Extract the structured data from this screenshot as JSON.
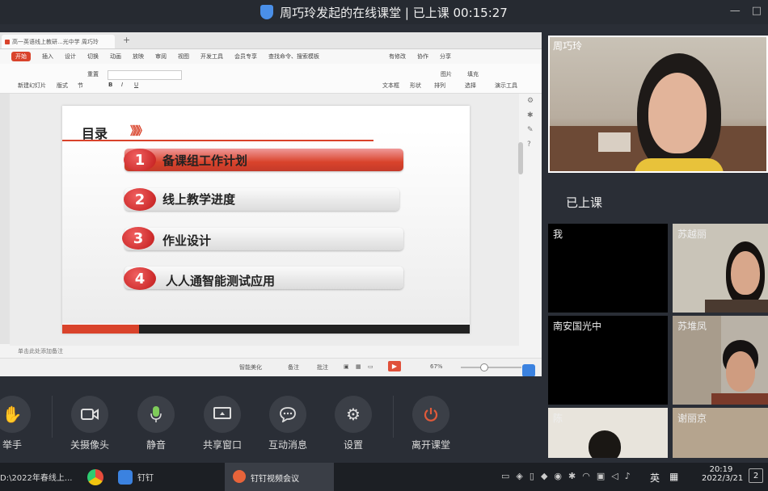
{
  "window": {
    "title": "周巧玲发起的在线课堂 | 已上课 00:15:27",
    "controls": [
      "—",
      "□"
    ]
  },
  "wps": {
    "doc_tab": "高一英语线上教研...光中学 周巧玲",
    "menu": [
      "开始",
      "插入",
      "设计",
      "切换",
      "动画",
      "放映",
      "审阅",
      "视图",
      "开发工具",
      "会员专享",
      "查找命令、搜索模板",
      "有修改",
      "协作",
      "分享"
    ],
    "ribbon": {
      "new_slide": "新建幻灯片",
      "layout": "版式",
      "section": "节",
      "reset": "重置",
      "textbox": "文本框",
      "shape": "形状",
      "arrange": "排列",
      "image": "图片",
      "fill": "填充",
      "play": "演示工具",
      "select": "选择"
    },
    "note_placeholder": "单击此处添加备注",
    "status": {
      "beautify": "智能美化",
      "notes": "备注",
      "annotate": "批注",
      "zoom": "67%"
    }
  },
  "slide": {
    "heading": "目录",
    "arrows": "》》》",
    "items": [
      {
        "num": "1",
        "text": "备课组工作计划"
      },
      {
        "num": "2",
        "text": "线上教学进度"
      },
      {
        "num": "3",
        "text": "作业设计"
      },
      {
        "num": "4",
        "text": "人人通智能测试应用"
      }
    ]
  },
  "controls": [
    {
      "label": "举手",
      "icon": "hand-icon"
    },
    {
      "label": "关摄像头",
      "icon": "camera-icon"
    },
    {
      "label": "静音",
      "icon": "microphone-icon"
    },
    {
      "label": "共享窗口",
      "icon": "screen-share-icon"
    },
    {
      "label": "互动消息",
      "icon": "chat-icon"
    },
    {
      "label": "设置",
      "icon": "gear-icon"
    },
    {
      "label": "离开课堂",
      "icon": "power-icon"
    }
  ],
  "participants": {
    "host": "周巧玲",
    "status": "已上课",
    "tiles": [
      "我",
      "苏越丽",
      "南安国光中",
      "苏堆凤",
      "陈",
      "谢丽京"
    ]
  },
  "taskbar": {
    "folder": "D:\\2022年春线上...",
    "dingtalk": "钉钉",
    "meeting": "钉钉视频会议",
    "lang": "英",
    "time": "20:19",
    "date": "2022/3/21",
    "notif_count": "2"
  },
  "colors": {
    "accent_red": "#d9432b",
    "dark_bg": "#2a2e36",
    "leave_red": "#e05a3a"
  }
}
